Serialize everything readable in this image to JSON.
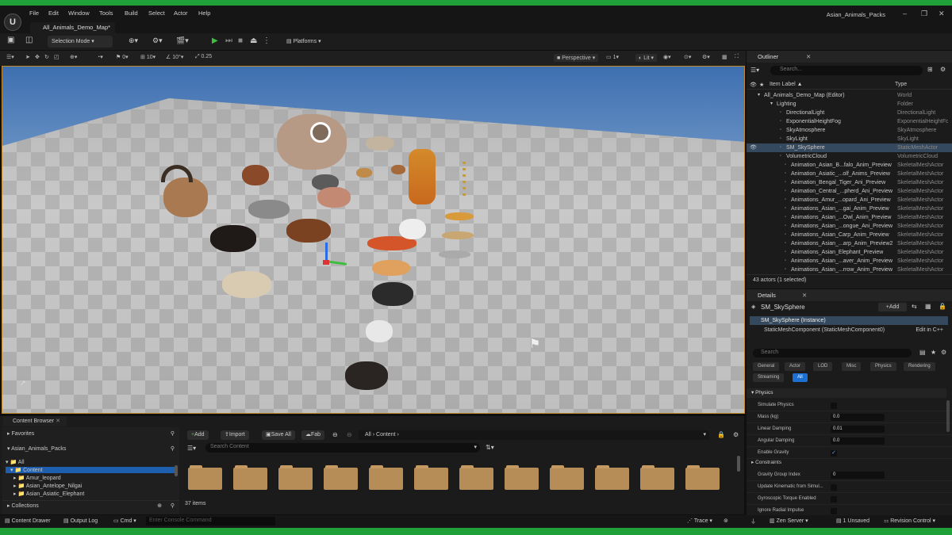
{
  "window": {
    "title": "Asian_Animals_Packs",
    "map_tab": "All_Animals_Demo_Map*"
  },
  "menu": [
    "File",
    "Edit",
    "Window",
    "Tools",
    "Build",
    "Select",
    "Actor",
    "Help"
  ],
  "toolbar": {
    "selection_mode": "Selection Mode",
    "platforms": "Platforms"
  },
  "viewport_tools": {
    "snap_angle": "0",
    "grid_size": "10",
    "rot_snap": "10°",
    "scale_snap": "0.25",
    "perspective": "Perspective",
    "lit": "Lit",
    "camera_speed": "1"
  },
  "outliner": {
    "title": "Outliner",
    "search_placeholder": "Search...",
    "col_label": "Item Label",
    "col_type": "Type",
    "footer": "43 actors (1 selected)",
    "rows": [
      {
        "label": "All_Animals_Demo_Map (Editor)",
        "type": "World"
      },
      {
        "label": "Lighting",
        "type": "Folder"
      },
      {
        "label": "DirectionalLight",
        "type": "DirectionalLight"
      },
      {
        "label": "ExponentialHeightFog",
        "type": "ExponentialHeightFog"
      },
      {
        "label": "SkyAtmosphere",
        "type": "SkyAtmosphere"
      },
      {
        "label": "SkyLight",
        "type": "SkyLight"
      },
      {
        "label": "SM_SkySphere",
        "type": "StaticMeshActor"
      },
      {
        "label": "VolumetricCloud",
        "type": "VolumetricCloud"
      },
      {
        "label": "Animation_Asian_B...falo_Anim_Preview",
        "type": "SkeletalMeshActor"
      },
      {
        "label": "Animation_Asiatic_...olf_Anims_Preview",
        "type": "SkeletalMeshActor"
      },
      {
        "label": "Animation_Bengal_Tiger_Ani_Preview",
        "type": "SkeletalMeshActor"
      },
      {
        "label": "Animation_Central_...pherd_Ani_Preview",
        "type": "SkeletalMeshActor"
      },
      {
        "label": "Animations_Amur_...opard_Ani_Preview",
        "type": "SkeletalMeshActor"
      },
      {
        "label": "Animations_Asian_...gai_Anim_Preview",
        "type": "SkeletalMeshActor"
      },
      {
        "label": "Animations_Asian_...Owl_Anim_Preview",
        "type": "SkeletalMeshActor"
      },
      {
        "label": "Animations_Asian_...ongue_Ani_Preview",
        "type": "SkeletalMeshActor"
      },
      {
        "label": "Animations_Asian_Carp_Anim_Preview",
        "type": "SkeletalMeshActor"
      },
      {
        "label": "Animations_Asian_...arp_Anim_Preview2",
        "type": "SkeletalMeshActor"
      },
      {
        "label": "Animations_Asian_Elephant_Preview",
        "type": "SkeletalMeshActor"
      },
      {
        "label": "Animations_Asian_...aver_Anim_Preview",
        "type": "SkeletalMeshActor"
      },
      {
        "label": "Animations_Asian_...rrow_Anim_Preview",
        "type": "SkeletalMeshActor"
      }
    ]
  },
  "details": {
    "title": "Details",
    "actor": "SM_SkySphere",
    "add": "Add",
    "instance": "SM_SkySphere (Instance)",
    "component": "StaticMeshComponent (StaticMeshComponent0)",
    "edit_cpp": "Edit in C++",
    "search_placeholder": "Search",
    "categories": [
      "General",
      "Actor",
      "LOD",
      "Misc",
      "Physics",
      "Rendering",
      "Streaming",
      "All"
    ],
    "section_physics": "Physics",
    "props": [
      {
        "label": "Simulate Physics",
        "kind": "check"
      },
      {
        "label": "Mass (kg)",
        "value": "0.0",
        "kind": "value"
      },
      {
        "label": "Linear Damping",
        "value": "0.01",
        "kind": "value"
      },
      {
        "label": "Angular Damping",
        "value": "0.0",
        "kind": "value"
      },
      {
        "label": "Enable Gravity",
        "kind": "check",
        "checked": true
      }
    ],
    "constraints": "Constraints",
    "props2": [
      {
        "label": "Gravity Group Index",
        "value": "0",
        "kind": "value"
      },
      {
        "label": "Update Kinematic from Simul...",
        "kind": "check"
      },
      {
        "label": "Gyroscopic Torque Enabled",
        "kind": "check"
      },
      {
        "label": "Ignore Radial Impulse",
        "kind": "check"
      }
    ]
  },
  "content_browser": {
    "tab": "Content Browser",
    "favorites": "Favorites",
    "project": "Asian_Animals_Packs",
    "collections": "Collections",
    "tree": [
      "All",
      "Content",
      "Amur_leopard",
      "Asian_Antelope_Nilgai",
      "Asian_Asiatic_Elephant"
    ],
    "add": "Add",
    "import": "Import",
    "save_all": "Save All",
    "fab": "Fab",
    "path_all": "All",
    "path_content": "Content",
    "search_placeholder": "Search Content",
    "count": "37 items"
  },
  "status": {
    "content_drawer": "Content Drawer",
    "output_log": "Output Log",
    "cmd": "Cmd",
    "console_placeholder": "Enter Console Command",
    "trace": "Trace",
    "zen": "Zen Server",
    "unsaved": "1 Unsaved",
    "revision": "Revision Control"
  }
}
